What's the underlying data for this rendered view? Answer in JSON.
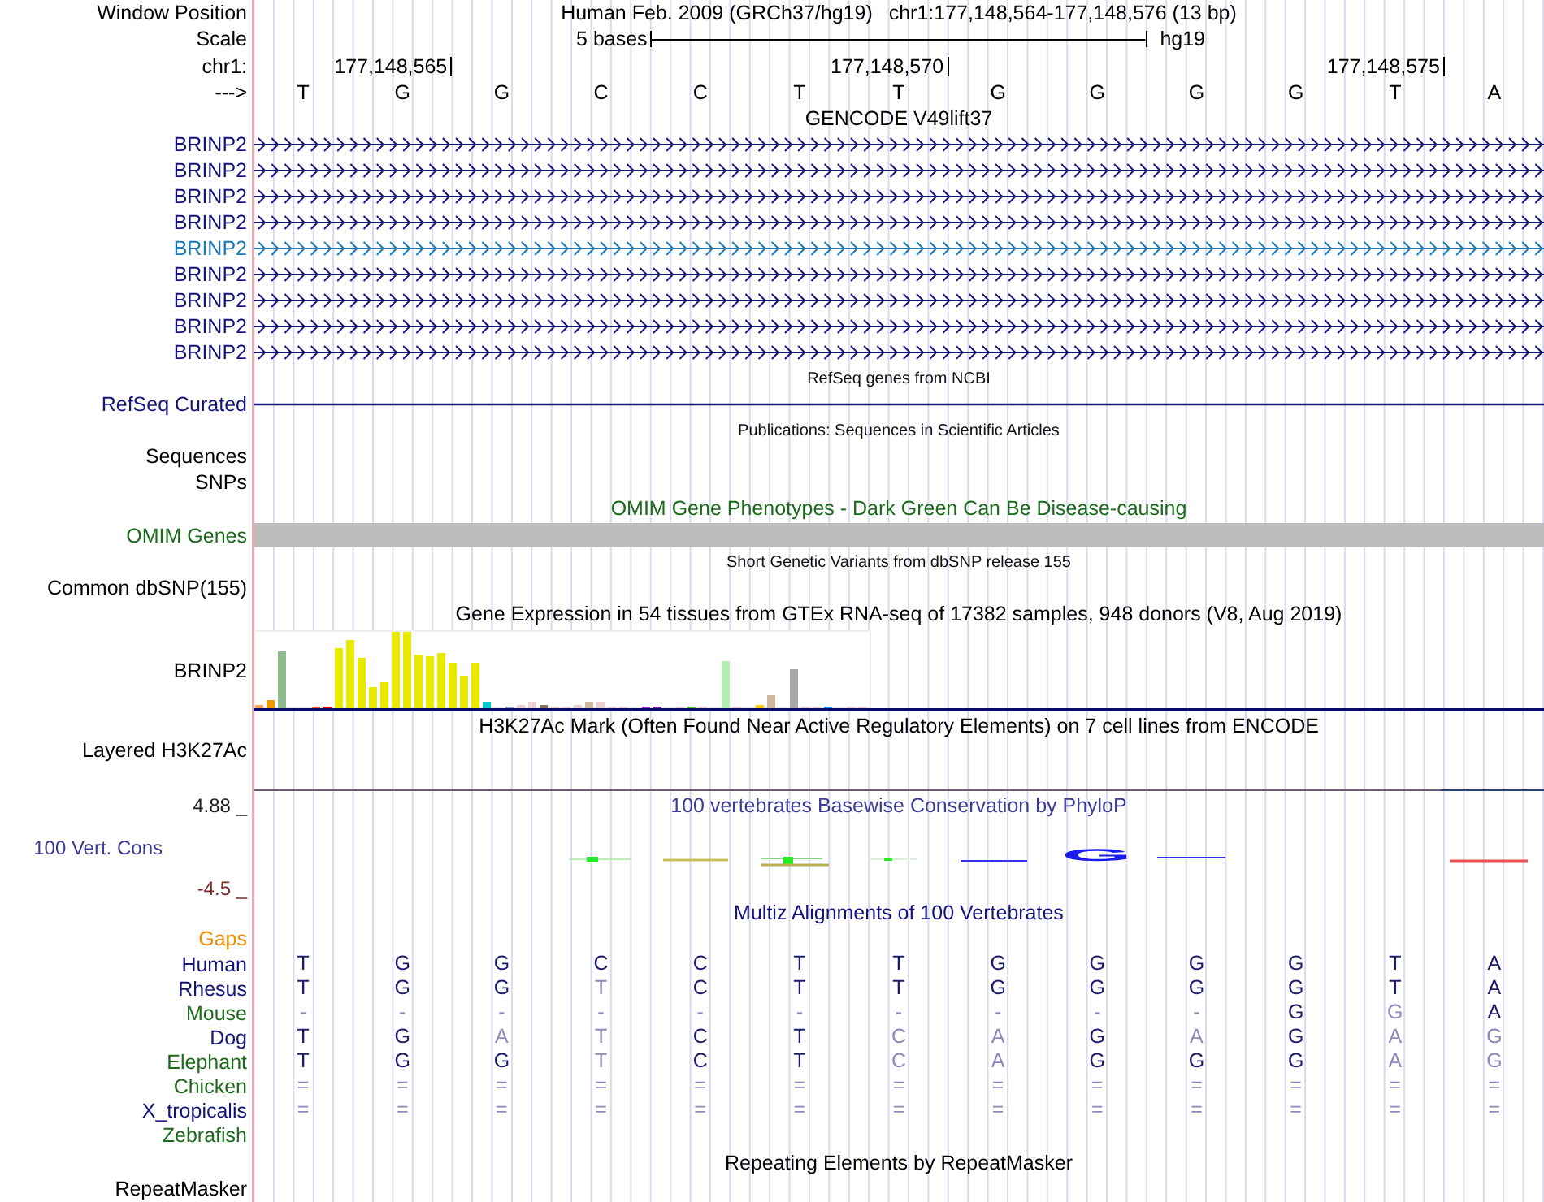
{
  "rows": [
    {
      "kind": "position",
      "label": "Window Position",
      "assembly": "Human Feb. 2009 (GRCh37/hg19)",
      "range": "chr1:177,148,564-177,148,576 (13 bp)"
    },
    {
      "kind": "scale",
      "label": "Scale",
      "left": "5 bases",
      "right": "hg19"
    },
    {
      "kind": "ruler",
      "label": "chr1:",
      "ticks": [
        "177,148,565",
        "177,148,570",
        "177,148,575"
      ]
    },
    {
      "kind": "bases",
      "label": "--->",
      "bases": [
        "T",
        "G",
        "G",
        "C",
        "C",
        "T",
        "T",
        "G",
        "G",
        "G",
        "G",
        "T",
        "A"
      ]
    },
    {
      "kind": "title",
      "text": "GENCODE V49lift37",
      "color": "#000000"
    },
    {
      "kind": "gene",
      "label": "BRINP2",
      "color": "#14147a"
    },
    {
      "kind": "gene",
      "label": "BRINP2",
      "color": "#14147a"
    },
    {
      "kind": "gene",
      "label": "BRINP2",
      "color": "#14147a"
    },
    {
      "kind": "gene",
      "label": "BRINP2",
      "color": "#14147a"
    },
    {
      "kind": "gene",
      "label": "BRINP2",
      "color": "#1c78b4"
    },
    {
      "kind": "gene",
      "label": "BRINP2",
      "color": "#14147a"
    },
    {
      "kind": "gene",
      "label": "BRINP2",
      "color": "#14147a"
    },
    {
      "kind": "gene",
      "label": "BRINP2",
      "color": "#14147a"
    },
    {
      "kind": "gene",
      "label": "BRINP2",
      "color": "#14147a"
    },
    {
      "kind": "note",
      "text": "RefSeq genes from NCBI"
    },
    {
      "kind": "line",
      "label": "RefSeq Curated",
      "color": "#14147a"
    },
    {
      "kind": "note",
      "text": "Publications: Sequences in Scientific Articles"
    },
    {
      "kind": "label",
      "label": "Sequences",
      "color": "#000000"
    },
    {
      "kind": "label",
      "label": "SNPs",
      "color": "#000000"
    },
    {
      "kind": "title",
      "text": "OMIM Gene Phenotypes - Dark Green Can Be Disease-causing",
      "color": "#1a6b1a"
    },
    {
      "kind": "bar",
      "label": "OMIM Genes",
      "color": "#1a6b1a"
    },
    {
      "kind": "note",
      "text": "Short Genetic Variants from dbSNP release 155"
    },
    {
      "kind": "label",
      "label": "Common dbSNP(155)",
      "color": "#000000"
    },
    {
      "kind": "title",
      "text": "Gene Expression in 54 tissues from GTEx RNA-seq of 17382 samples, 948 donors (V8, Aug 2019)",
      "color": "#000000"
    },
    {
      "kind": "expression",
      "label": "BRINP2"
    },
    {
      "kind": "title",
      "text": "H3K27Ac Mark (Often Found Near Active Regulatory Elements) on 7 cell lines from ENCODE",
      "color": "#000000"
    },
    {
      "kind": "layered",
      "label": "Layered H3K27Ac"
    },
    {
      "kind": "conservation",
      "top": "4.88 _",
      "label": "100 Vert. Cons",
      "bottom": "-4.5 _",
      "title": "100 vertebrates Basewise Conservation by PhyloP",
      "logo": "G"
    },
    {
      "kind": "title",
      "text": "Multiz Alignments of 100 Vertebrates",
      "color": "#14147a"
    },
    {
      "kind": "label",
      "label": "Gaps",
      "color": "#f08c00"
    },
    {
      "kind": "species",
      "label": "Human",
      "color": "#14147a",
      "bases": [
        {
          "base": "T",
          "dim": false
        },
        {
          "base": "G",
          "dim": false
        },
        {
          "base": "G",
          "dim": false
        },
        {
          "base": "C",
          "dim": false
        },
        {
          "base": "C",
          "dim": false
        },
        {
          "base": "T",
          "dim": false
        },
        {
          "base": "T",
          "dim": false
        },
        {
          "base": "G",
          "dim": false
        },
        {
          "base": "G",
          "dim": false
        },
        {
          "base": "G",
          "dim": false
        },
        {
          "base": "G",
          "dim": false
        },
        {
          "base": "T",
          "dim": false
        },
        {
          "base": "A",
          "dim": false
        }
      ]
    },
    {
      "kind": "species",
      "label": "Rhesus",
      "color": "#14147a",
      "bases": [
        {
          "base": "T",
          "dim": false
        },
        {
          "base": "G",
          "dim": false
        },
        {
          "base": "G",
          "dim": false
        },
        {
          "base": "T",
          "dim": true
        },
        {
          "base": "C",
          "dim": false
        },
        {
          "base": "T",
          "dim": false
        },
        {
          "base": "T",
          "dim": false
        },
        {
          "base": "G",
          "dim": false
        },
        {
          "base": "G",
          "dim": false
        },
        {
          "base": "G",
          "dim": false
        },
        {
          "base": "G",
          "dim": false
        },
        {
          "base": "T",
          "dim": false
        },
        {
          "base": "A",
          "dim": false
        }
      ]
    },
    {
      "kind": "species",
      "label": "Mouse",
      "color": "#1a6b1a",
      "bases": [
        {
          "base": "-",
          "dim": true
        },
        {
          "base": "-",
          "dim": true
        },
        {
          "base": "-",
          "dim": true
        },
        {
          "base": "-",
          "dim": true
        },
        {
          "base": "-",
          "dim": true
        },
        {
          "base": "-",
          "dim": true
        },
        {
          "base": "-",
          "dim": true
        },
        {
          "base": "-",
          "dim": true
        },
        {
          "base": "-",
          "dim": true
        },
        {
          "base": "-",
          "dim": true
        },
        {
          "base": "G",
          "dim": false
        },
        {
          "base": "G",
          "dim": true
        },
        {
          "base": "A",
          "dim": false
        }
      ]
    },
    {
      "kind": "species",
      "label": "Dog",
      "color": "#14147a",
      "bases": [
        {
          "base": "T",
          "dim": false
        },
        {
          "base": "G",
          "dim": false
        },
        {
          "base": "A",
          "dim": true
        },
        {
          "base": "T",
          "dim": true
        },
        {
          "base": "C",
          "dim": false
        },
        {
          "base": "T",
          "dim": false
        },
        {
          "base": "C",
          "dim": true
        },
        {
          "base": "A",
          "dim": true
        },
        {
          "base": "G",
          "dim": false
        },
        {
          "base": "A",
          "dim": true
        },
        {
          "base": "G",
          "dim": false
        },
        {
          "base": "A",
          "dim": true
        },
        {
          "base": "G",
          "dim": true
        }
      ]
    },
    {
      "kind": "species",
      "label": "Elephant",
      "color": "#1a6b1a",
      "bases": [
        {
          "base": "T",
          "dim": false
        },
        {
          "base": "G",
          "dim": false
        },
        {
          "base": "G",
          "dim": false
        },
        {
          "base": "T",
          "dim": true
        },
        {
          "base": "C",
          "dim": false
        },
        {
          "base": "T",
          "dim": false
        },
        {
          "base": "C",
          "dim": true
        },
        {
          "base": "A",
          "dim": true
        },
        {
          "base": "G",
          "dim": false
        },
        {
          "base": "G",
          "dim": false
        },
        {
          "base": "G",
          "dim": false
        },
        {
          "base": "A",
          "dim": true
        },
        {
          "base": "G",
          "dim": true
        }
      ]
    },
    {
      "kind": "species",
      "label": "Chicken",
      "color": "#1a6b1a",
      "bases": [
        {
          "base": "=",
          "dim": true
        },
        {
          "base": "=",
          "dim": true
        },
        {
          "base": "=",
          "dim": true
        },
        {
          "base": "=",
          "dim": true
        },
        {
          "base": "=",
          "dim": true
        },
        {
          "base": "=",
          "dim": true
        },
        {
          "base": "=",
          "dim": true
        },
        {
          "base": "=",
          "dim": true
        },
        {
          "base": "=",
          "dim": true
        },
        {
          "base": "=",
          "dim": true
        },
        {
          "base": "=",
          "dim": true
        },
        {
          "base": "=",
          "dim": true
        },
        {
          "base": "=",
          "dim": true
        }
      ]
    },
    {
      "kind": "species",
      "label": "X_tropicalis",
      "color": "#14147a",
      "bases": [
        {
          "base": "=",
          "dim": true
        },
        {
          "base": "=",
          "dim": true
        },
        {
          "base": "=",
          "dim": true
        },
        {
          "base": "=",
          "dim": true
        },
        {
          "base": "=",
          "dim": true
        },
        {
          "base": "=",
          "dim": true
        },
        {
          "base": "=",
          "dim": true
        },
        {
          "base": "=",
          "dim": true
        },
        {
          "base": "=",
          "dim": true
        },
        {
          "base": "=",
          "dim": true
        },
        {
          "base": "=",
          "dim": true
        },
        {
          "base": "=",
          "dim": true
        },
        {
          "base": "=",
          "dim": true
        }
      ]
    },
    {
      "kind": "species",
      "label": "Zebrafish",
      "color": "#1a6b1a",
      "bases": []
    },
    {
      "kind": "spacer"
    },
    {
      "kind": "title",
      "text": "Repeating Elements by RepeatMasker",
      "color": "#000000"
    },
    {
      "kind": "label",
      "label": "RepeatMasker",
      "color": "#000000"
    }
  ]
}
